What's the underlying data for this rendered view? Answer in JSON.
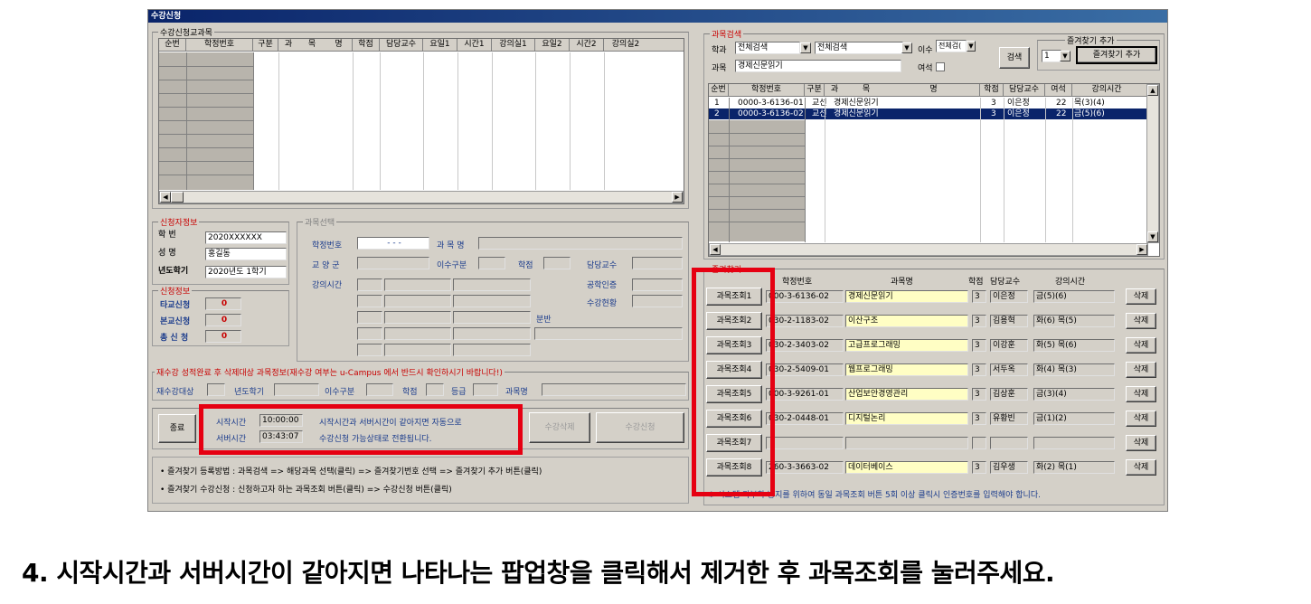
{
  "window": {
    "title": "수강신청"
  },
  "left_panel": {
    "group_label": "수강신청교과목",
    "columns": [
      "순번",
      "학정번호",
      "구분",
      "과",
      "목",
      "명",
      "학점",
      "담당교수",
      "요일1",
      "시간1",
      "강의실1",
      "요일2",
      "시간2",
      "강의실2"
    ]
  },
  "applicant": {
    "group_label": "신청자정보",
    "student_id_label": "학 번",
    "student_id": "2020XXXXXX",
    "name_label": "성 명",
    "name": "홍길동",
    "year_label": "년도학기",
    "year": "2020년도 1학기"
  },
  "application": {
    "group_label": "신청정보",
    "other_label": "타교신청",
    "other_value": "0",
    "home_label": "본교신청",
    "home_value": "0",
    "total_label": "총 신 청",
    "total_value": "0"
  },
  "course_select": {
    "group_label": "과목선택",
    "code_label": "학정번호",
    "code_value": "- - -",
    "name_label": "과 목 명",
    "area_label": "교 양 군",
    "type_label": "이수구분",
    "credit_label": "학점",
    "prof_label": "담당교수",
    "time_label": "강의시간",
    "cert_label": "공학인증",
    "status_label": "수강현황",
    "section_label": "분반"
  },
  "retake": {
    "label": "재수강 성적완료 후 삭제대상 과목정보(재수강 여부는 u-Campus 에서 반드시 확인하시기 바랍니다!)",
    "target_label": "재수강대상",
    "year_label": "년도학기",
    "type_label": "이수구분",
    "credit_label": "학점",
    "grade_label": "등급",
    "course_label": "과목명"
  },
  "actions": {
    "exit": "종료",
    "start_time_label": "시작시간",
    "start_time": "10:00:00",
    "server_time_label": "서버시간",
    "server_time": "03:43:07",
    "notice1": "시작시간과 서버시간이 같아지면 자동으로",
    "notice2": "수강신청 가능상태로 전환됩니다.",
    "delete": "수강삭제",
    "apply": "수강신청"
  },
  "help": {
    "line1": "• 즐겨찾기 등록방법 : 과목검색 => 해당과목 선택(클릭) => 즐겨찾기번호 선택 => 즐겨찾기 추가 버튼(클릭)",
    "line2": "• 즐겨찾기 수강신청 : 신청하고자 하는 과목조회 버튼(클릭) => 수강신청 버튼(클릭)"
  },
  "search": {
    "group_label": "과목검색",
    "dept_label": "학과",
    "dept_value1": "전체검색",
    "dept_value2": "전체검색",
    "type_label": "이수",
    "type_value": "전체검(",
    "course_label": "과목",
    "course_value": "경제신문읽기",
    "seat_label": "여석",
    "search_btn": "검색",
    "fav_group_label": "즐겨찾기 추가",
    "fav_num": "1",
    "fav_add_btn": "즐겨찾기 추가",
    "columns": [
      "순번",
      "학정번호",
      "구분",
      "과",
      "목",
      "명",
      "학점",
      "담당교수",
      "여석",
      "강의시간"
    ],
    "rows": [
      {
        "no": "1",
        "code": "0000-3-6136-01",
        "type": "교선",
        "name": "경제신문읽기",
        "credit": "3",
        "prof": "이은정",
        "seats": "22",
        "time": "목(3)(4)"
      },
      {
        "no": "2",
        "code": "0000-3-6136-02",
        "type": "교선",
        "name": "경제신문읽기",
        "credit": "3",
        "prof": "이은정",
        "seats": "22",
        "time": "금(5)(6)"
      }
    ]
  },
  "favorites": {
    "group_label": "즐겨찾기",
    "h_code": "학정번호",
    "h_name": "과목명",
    "h_credit": "학점",
    "h_prof": "담당교수",
    "h_time": "강의시간",
    "delete_label": "삭제",
    "rows": [
      {
        "btn": "과목조회1",
        "code": "000-3-6136-02",
        "name": "경제신문읽기",
        "credit": "3",
        "prof": "이은정",
        "time": "금(5)(6)"
      },
      {
        "btn": "과목조회2",
        "code": "030-2-1183-02",
        "name": "이산구조",
        "credit": "3",
        "prof": "김용혁",
        "time": "화(6) 목(5)"
      },
      {
        "btn": "과목조회3",
        "code": "030-2-3403-02",
        "name": "고급프로그래밍",
        "credit": "3",
        "prof": "이강훈",
        "time": "화(5) 목(6)"
      },
      {
        "btn": "과목조회4",
        "code": "030-2-5409-01",
        "name": "웹프로그래밍",
        "credit": "3",
        "prof": "서두옥",
        "time": "화(4) 목(3)"
      },
      {
        "btn": "과목조회5",
        "code": "000-3-9261-01",
        "name": "산업보안경영관리",
        "credit": "3",
        "prof": "김상훈",
        "time": "금(3)(4)"
      },
      {
        "btn": "과목조회6",
        "code": "030-2-0448-01",
        "name": "디지털논리",
        "credit": "3",
        "prof": "유황빈",
        "time": "금(1)(2)"
      },
      {
        "btn": "과목조회7",
        "code": "",
        "name": "",
        "credit": "",
        "prof": "",
        "time": ""
      },
      {
        "btn": "과목조회8",
        "code": "260-3-3663-02",
        "name": "데이터베이스",
        "credit": "3",
        "prof": "김우생",
        "time": "화(2) 목(1)"
      }
    ],
    "warning": "※ 시스템 과부하 방지를 위하여 동일 과목조회 버튼 5회 이상 클릭시 인증번호를 입력해야 합니다."
  },
  "caption": "4. 시작시간과 서버시간이 같아지면 나타나는 팝업창을 클릭해서 제거한 후 과목조회를 눌러주세요.",
  "colors": {
    "highlight": "#e60012",
    "selection": "#0a246a",
    "field_yellow": "#fffec4",
    "dialog": "#d4d0c8",
    "red_text": "#c80000"
  }
}
